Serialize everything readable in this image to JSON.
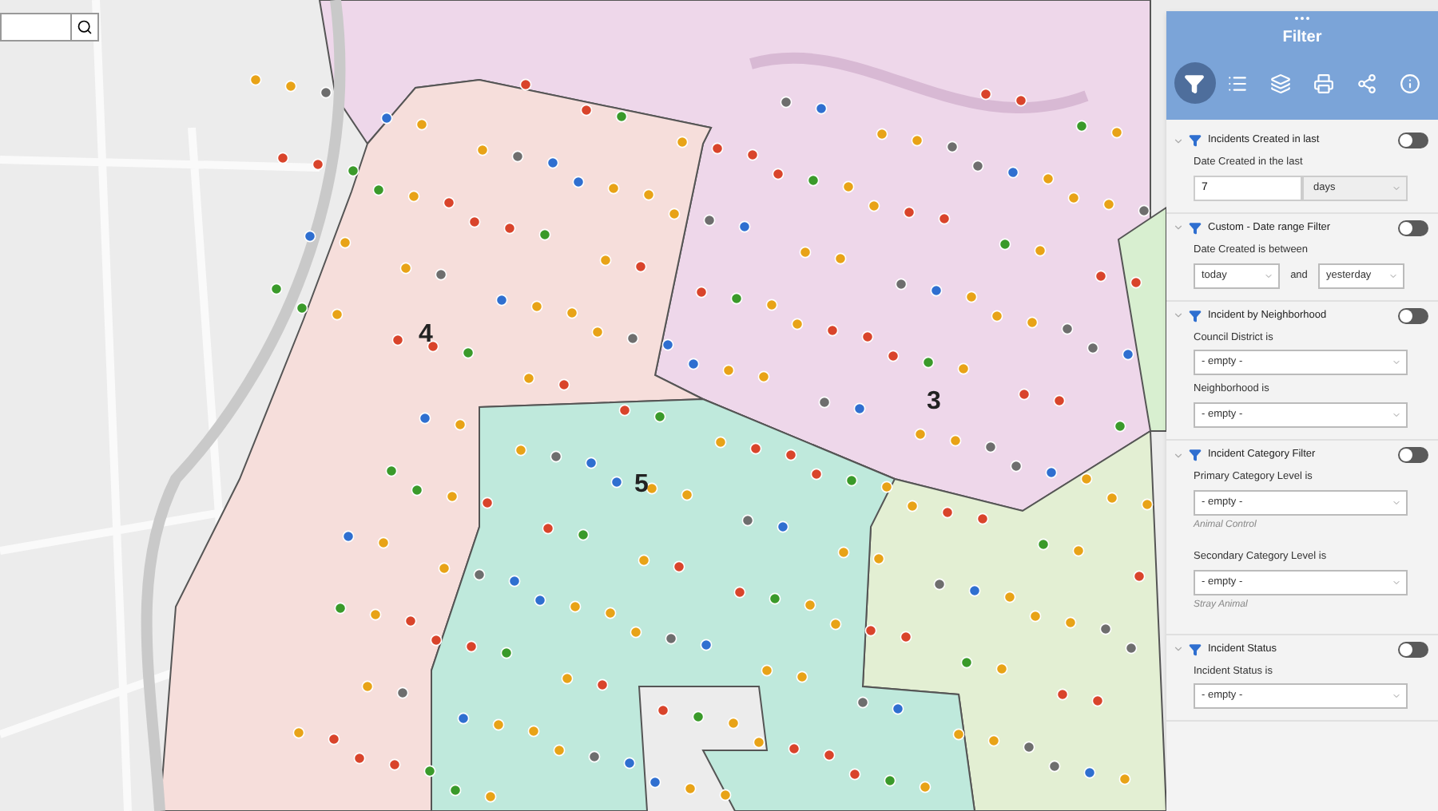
{
  "map": {
    "districts": [
      {
        "label": "4"
      },
      {
        "label": "3"
      },
      {
        "label": "5"
      }
    ]
  },
  "panel": {
    "title": "Filter",
    "tools": [
      {
        "kind": "filter",
        "selected": true
      },
      {
        "kind": "list",
        "selected": false
      },
      {
        "kind": "layers",
        "selected": false
      },
      {
        "kind": "print",
        "selected": false
      },
      {
        "kind": "share",
        "selected": false
      },
      {
        "kind": "info",
        "selected": false
      }
    ],
    "sections": [
      {
        "title": "Incidents Created in last",
        "on": false,
        "fields": [
          {
            "kind": "number_unit",
            "label": "Date Created in the last",
            "value": "7",
            "unit": "days"
          }
        ]
      },
      {
        "title": "Custom - Date range Filter",
        "on": false,
        "fields": [
          {
            "kind": "range",
            "label": "Date Created is between",
            "from": "today",
            "joiner": "and",
            "to": "yesterday"
          }
        ]
      },
      {
        "title": "Incident by Neighborhood",
        "on": false,
        "fields": [
          {
            "kind": "select",
            "label": "Council District is",
            "value": "- empty -"
          },
          {
            "kind": "select",
            "label": "Neighborhood is",
            "value": "- empty -"
          }
        ]
      },
      {
        "title": "Incident Category Filter",
        "on": false,
        "fields": [
          {
            "kind": "select",
            "label": "Primary Category Level is",
            "value": "- empty -",
            "hint": "Animal Control"
          },
          {
            "kind": "select",
            "label": "Secondary Category Level is",
            "value": "- empty -",
            "hint": "Stray Animal"
          }
        ]
      },
      {
        "title": "Incident Status",
        "on": false,
        "fields": [
          {
            "kind": "select",
            "label": "Incident Status is",
            "value": "- empty -"
          }
        ]
      }
    ]
  }
}
